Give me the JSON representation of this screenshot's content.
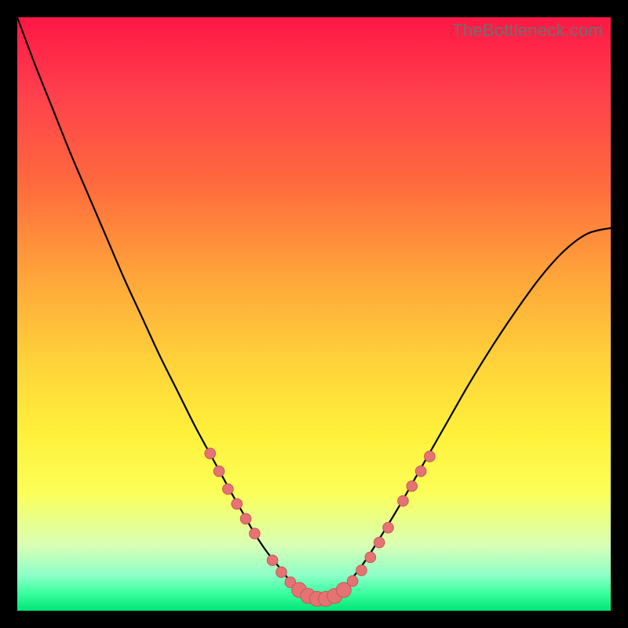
{
  "watermark": "TheBottleneck.com",
  "colors": {
    "curve": "#000000",
    "marker_fill": "#e57373",
    "marker_stroke": "#c75858",
    "background_top": "#ff1744",
    "background_bottom": "#00e676",
    "frame": "#000000"
  },
  "chart_data": {
    "type": "line",
    "title": "",
    "xlabel": "",
    "ylabel": "",
    "xlim": [
      0,
      100
    ],
    "ylim": [
      0,
      100
    ],
    "grid": false,
    "series": [
      {
        "name": "bottleneck-curve",
        "x": [
          0,
          3,
          6,
          9,
          12,
          15,
          18,
          21,
          24,
          27,
          30,
          33,
          36,
          38,
          40,
          42,
          44,
          46,
          48,
          50,
          52,
          54,
          56,
          58,
          60,
          64,
          68,
          72,
          76,
          80,
          84,
          88,
          92,
          96,
          100
        ],
        "y": [
          100,
          92,
          84.5,
          77,
          70,
          63,
          56,
          49.5,
          43,
          37,
          31,
          25.5,
          20,
          16.5,
          13,
          10,
          7.5,
          5,
          3.2,
          2,
          2,
          3.2,
          5,
          7.5,
          10.5,
          17,
          24,
          31,
          38,
          44.5,
          50.5,
          56,
          60.5,
          63.5,
          64.5
        ]
      }
    ],
    "markers": [
      {
        "x": 32.5,
        "y": 26.5,
        "r": 1.0
      },
      {
        "x": 34.0,
        "y": 23.5,
        "r": 1.0
      },
      {
        "x": 35.5,
        "y": 20.5,
        "r": 1.0
      },
      {
        "x": 37.0,
        "y": 18.0,
        "r": 1.0
      },
      {
        "x": 38.5,
        "y": 15.5,
        "r": 1.0
      },
      {
        "x": 40.0,
        "y": 13.0,
        "r": 1.0
      },
      {
        "x": 43.0,
        "y": 8.5,
        "r": 1.0
      },
      {
        "x": 44.5,
        "y": 6.5,
        "r": 1.0
      },
      {
        "x": 46.0,
        "y": 4.8,
        "r": 1.0
      },
      {
        "x": 47.5,
        "y": 3.5,
        "r": 1.4
      },
      {
        "x": 49.0,
        "y": 2.5,
        "r": 1.4
      },
      {
        "x": 50.5,
        "y": 2.0,
        "r": 1.4
      },
      {
        "x": 52.0,
        "y": 2.0,
        "r": 1.4
      },
      {
        "x": 53.5,
        "y": 2.5,
        "r": 1.4
      },
      {
        "x": 55.0,
        "y": 3.5,
        "r": 1.4
      },
      {
        "x": 56.5,
        "y": 5.0,
        "r": 1.0
      },
      {
        "x": 58.0,
        "y": 6.8,
        "r": 1.0
      },
      {
        "x": 59.5,
        "y": 9.0,
        "r": 1.0
      },
      {
        "x": 61.0,
        "y": 11.5,
        "r": 1.0
      },
      {
        "x": 62.5,
        "y": 14.0,
        "r": 1.0
      },
      {
        "x": 65.0,
        "y": 18.5,
        "r": 1.0
      },
      {
        "x": 66.5,
        "y": 21.0,
        "r": 1.0
      },
      {
        "x": 68.0,
        "y": 23.5,
        "r": 1.0
      },
      {
        "x": 69.5,
        "y": 26.0,
        "r": 1.0
      }
    ]
  }
}
